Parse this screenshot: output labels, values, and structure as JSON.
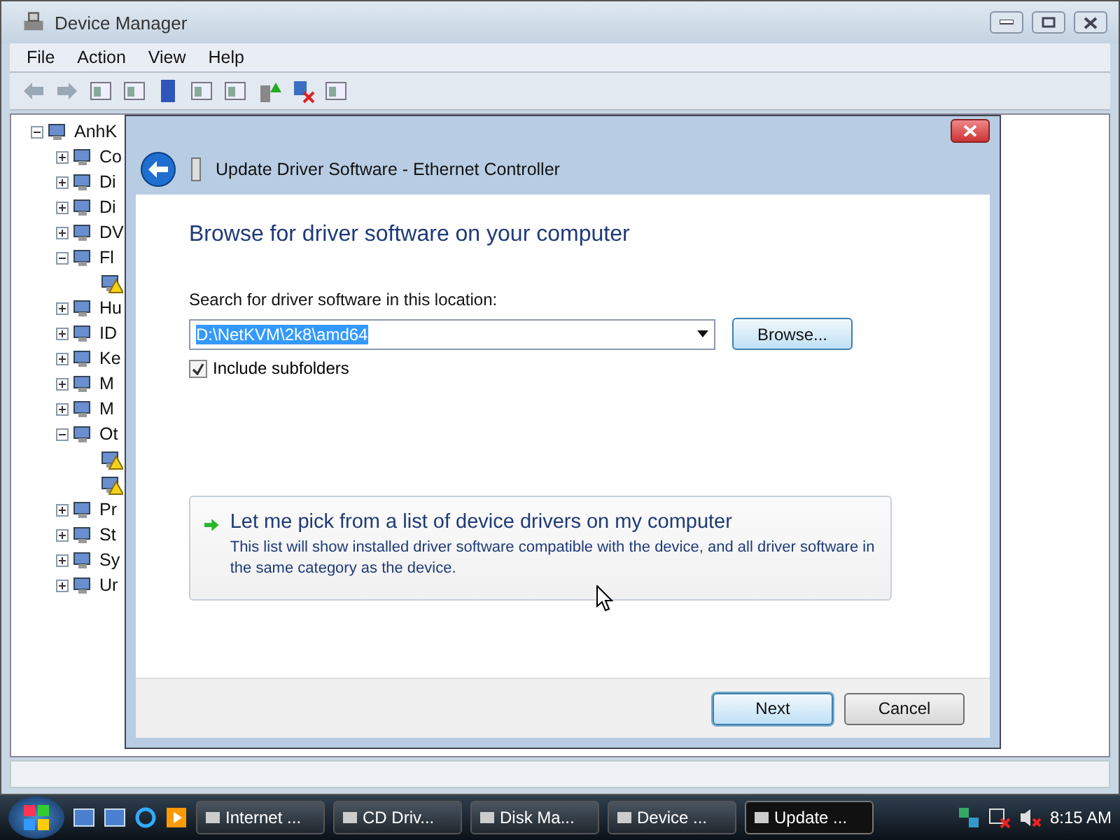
{
  "window": {
    "title": "Device Manager",
    "menu": [
      "File",
      "Action",
      "View",
      "Help"
    ]
  },
  "tree": {
    "label": "AnhK",
    "expanded": true,
    "children": [
      {
        "label": "Co",
        "expanded": false
      },
      {
        "label": "Di",
        "expanded": false
      },
      {
        "label": "Di",
        "expanded": false
      },
      {
        "label": "DV",
        "expanded": false
      },
      {
        "label": "Fl",
        "expanded": true,
        "children": [
          {
            "kind": "warning"
          }
        ]
      },
      {
        "label": "Hu",
        "expanded": false
      },
      {
        "label": "ID",
        "expanded": false
      },
      {
        "label": "Ke",
        "expanded": false
      },
      {
        "label": "M",
        "expanded": false
      },
      {
        "label": "M",
        "expanded": false
      },
      {
        "label": "Ot",
        "expanded": true,
        "children": [
          {
            "kind": "warning"
          },
          {
            "kind": "warning"
          }
        ]
      },
      {
        "label": "Pr",
        "expanded": false
      },
      {
        "label": "St",
        "expanded": false
      },
      {
        "label": "Sy",
        "expanded": false
      },
      {
        "label": "Ur",
        "expanded": false
      }
    ]
  },
  "dialog": {
    "title": "Update Driver Software - Ethernet Controller",
    "heading": "Browse for driver software on your computer",
    "location_label": "Search for driver software in this location:",
    "location_value": "D:\\NetKVM\\2k8\\amd64",
    "browse_button": "Browse...",
    "include_subfolders": {
      "label": "Include subfolders",
      "checked": true
    },
    "option": {
      "title": "Let me pick from a list of device drivers on my computer",
      "description": "This list will show installed driver software compatible with the device, and all driver software in the same category as the device."
    },
    "buttons": [
      {
        "label": "Next",
        "default": true
      },
      {
        "label": "Cancel",
        "default": false
      }
    ]
  },
  "taskbar": {
    "tasks": [
      {
        "label": "Internet ...",
        "selected": false
      },
      {
        "label": "CD Driv...",
        "selected": false
      },
      {
        "label": "Disk Ma...",
        "selected": false
      },
      {
        "label": "Device ...",
        "selected": false
      },
      {
        "label": "Update ...",
        "selected": true
      }
    ],
    "clock": "8:15 AM"
  }
}
